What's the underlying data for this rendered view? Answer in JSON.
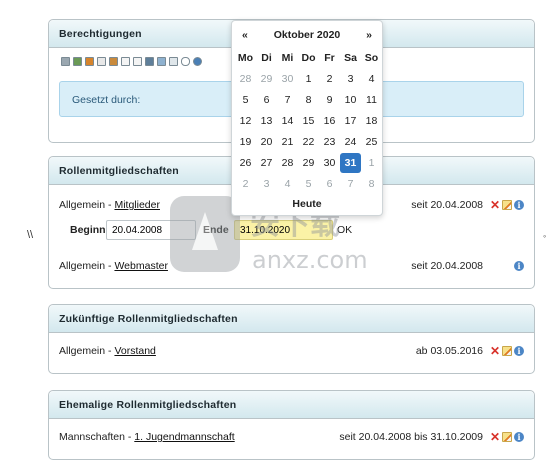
{
  "left_marker": "\\\\",
  "right_marker": "◦",
  "berechtigungen": {
    "title": "Berechtigungen",
    "toolbar_icons": [
      "person-icon",
      "group-icon",
      "home-icon",
      "mail-icon",
      "user-icon",
      "list-icon",
      "table-icon",
      "image-icon",
      "copy-icon",
      "doc-icon",
      "comment-icon",
      "link-icon"
    ],
    "gesetzt_label": "Gesetzt durch:"
  },
  "calendar": {
    "prev": "«",
    "next": "»",
    "month_title": "Oktober 2020",
    "weekdays": [
      "Mo",
      "Di",
      "Mi",
      "Do",
      "Fr",
      "Sa",
      "So"
    ],
    "weeks": [
      [
        "28",
        "29",
        "30",
        "1",
        "2",
        "3",
        "4"
      ],
      [
        "5",
        "6",
        "7",
        "8",
        "9",
        "10",
        "11"
      ],
      [
        "12",
        "13",
        "14",
        "15",
        "16",
        "17",
        "18"
      ],
      [
        "19",
        "20",
        "21",
        "22",
        "23",
        "24",
        "25"
      ],
      [
        "26",
        "27",
        "28",
        "29",
        "30",
        "31",
        "1"
      ],
      [
        "2",
        "3",
        "4",
        "5",
        "6",
        "7",
        "8"
      ]
    ],
    "selected_day": "31",
    "today_label": "Heute"
  },
  "rollen": {
    "title": "Rollenmitgliedschaften",
    "items": [
      {
        "category": "Allgemein - ",
        "role": "Mitglieder",
        "date": "seit 20.04.2008"
      },
      {
        "category": "Allgemein - ",
        "role": "Webmaster",
        "date": "seit 20.04.2008"
      }
    ],
    "edit": {
      "begin_label": "Beginn",
      "begin_value": "20.04.2008",
      "end_label": "Ende",
      "end_value": "31.10.2020",
      "ok_label": "OK"
    }
  },
  "zukuenftige": {
    "title": "Zukünftige Rollenmitgliedschaften",
    "items": [
      {
        "category": "Allgemein - ",
        "role": "Vorstand",
        "date": "ab 03.05.2016"
      }
    ]
  },
  "ehemalige": {
    "title": "Ehemalige Rollenmitgliedschaften",
    "items": [
      {
        "category": "Mannschaften - ",
        "role": "1. Jugendmannschaft",
        "date": "seit 20.04.2008 bis 31.10.2009"
      }
    ]
  },
  "watermark": {
    "text_top": "安下载",
    "text_bottom": "anxz.com"
  },
  "colors": {
    "accent": "#2f76c3",
    "header_bg": "#d3e8ee",
    "info_bg": "#d9eef8",
    "danger": "#d8322a"
  }
}
